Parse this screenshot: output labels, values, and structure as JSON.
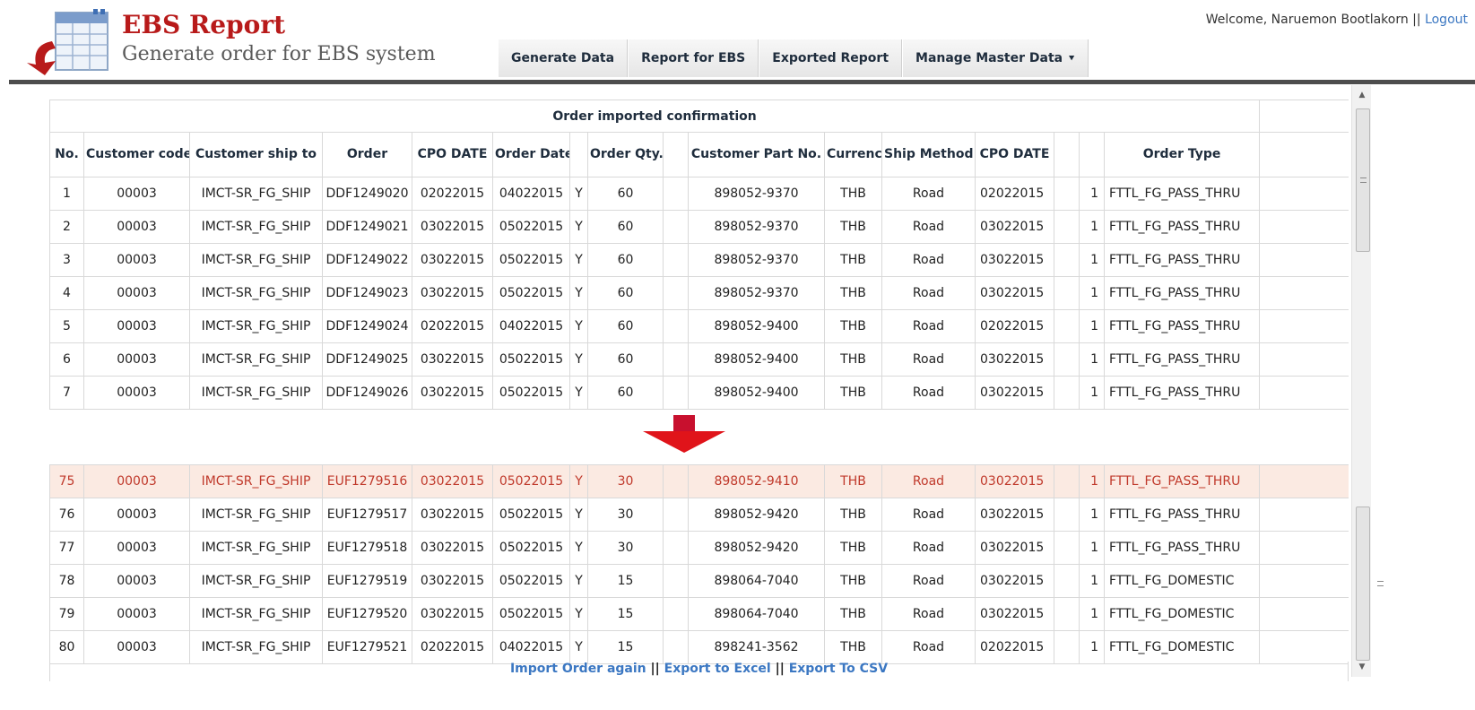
{
  "header": {
    "title": "EBS Report",
    "subtitle": "Generate order for EBS system",
    "welcome_text": "Welcome, Naruemon Bootlakorn ||",
    "logout_label": "Logout"
  },
  "nav": {
    "tabs": [
      {
        "label": "Generate Data"
      },
      {
        "label": "Report for EBS"
      },
      {
        "label": "Exported Report"
      },
      {
        "label": "Manage Master Data"
      }
    ]
  },
  "table": {
    "caption": "Order imported confirmation",
    "columns": [
      "No.",
      "Customer code",
      "Customer ship to",
      "Order",
      "CPO DATE",
      "Order Date",
      "",
      "Order Qty.",
      "",
      "Customer Part No.",
      "Currency",
      "Ship Method",
      "CPO DATE",
      "",
      "",
      "Order Type"
    ],
    "top_rows": [
      [
        "1",
        "00003",
        "IMCT-SR_FG_SHIP",
        "DDF1249020",
        "02022015",
        "04022015",
        "Y",
        "60",
        "",
        "898052-9370",
        "THB",
        "Road",
        "02022015",
        "",
        "1",
        "FTTL_FG_PASS_THRU"
      ],
      [
        "2",
        "00003",
        "IMCT-SR_FG_SHIP",
        "DDF1249021",
        "03022015",
        "05022015",
        "Y",
        "60",
        "",
        "898052-9370",
        "THB",
        "Road",
        "03022015",
        "",
        "1",
        "FTTL_FG_PASS_THRU"
      ],
      [
        "3",
        "00003",
        "IMCT-SR_FG_SHIP",
        "DDF1249022",
        "03022015",
        "05022015",
        "Y",
        "60",
        "",
        "898052-9370",
        "THB",
        "Road",
        "03022015",
        "",
        "1",
        "FTTL_FG_PASS_THRU"
      ],
      [
        "4",
        "00003",
        "IMCT-SR_FG_SHIP",
        "DDF1249023",
        "03022015",
        "05022015",
        "Y",
        "60",
        "",
        "898052-9370",
        "THB",
        "Road",
        "03022015",
        "",
        "1",
        "FTTL_FG_PASS_THRU"
      ],
      [
        "5",
        "00003",
        "IMCT-SR_FG_SHIP",
        "DDF1249024",
        "02022015",
        "04022015",
        "Y",
        "60",
        "",
        "898052-9400",
        "THB",
        "Road",
        "02022015",
        "",
        "1",
        "FTTL_FG_PASS_THRU"
      ],
      [
        "6",
        "00003",
        "IMCT-SR_FG_SHIP",
        "DDF1249025",
        "03022015",
        "05022015",
        "Y",
        "60",
        "",
        "898052-9400",
        "THB",
        "Road",
        "03022015",
        "",
        "1",
        "FTTL_FG_PASS_THRU"
      ],
      [
        "7",
        "00003",
        "IMCT-SR_FG_SHIP",
        "DDF1249026",
        "03022015",
        "05022015",
        "Y",
        "60",
        "",
        "898052-9400",
        "THB",
        "Road",
        "03022015",
        "",
        "1",
        "FTTL_FG_PASS_THRU"
      ]
    ],
    "bottom_rows": [
      [
        "75",
        "00003",
        "IMCT-SR_FG_SHIP",
        "EUF1279516",
        "03022015",
        "05022015",
        "Y",
        "30",
        "",
        "898052-9410",
        "THB",
        "Road",
        "03022015",
        "",
        "1",
        "FTTL_FG_PASS_THRU"
      ],
      [
        "76",
        "00003",
        "IMCT-SR_FG_SHIP",
        "EUF1279517",
        "03022015",
        "05022015",
        "Y",
        "30",
        "",
        "898052-9420",
        "THB",
        "Road",
        "03022015",
        "",
        "1",
        "FTTL_FG_PASS_THRU"
      ],
      [
        "77",
        "00003",
        "IMCT-SR_FG_SHIP",
        "EUF1279518",
        "03022015",
        "05022015",
        "Y",
        "30",
        "",
        "898052-9420",
        "THB",
        "Road",
        "03022015",
        "",
        "1",
        "FTTL_FG_PASS_THRU"
      ],
      [
        "78",
        "00003",
        "IMCT-SR_FG_SHIP",
        "EUF1279519",
        "03022015",
        "05022015",
        "Y",
        "15",
        "",
        "898064-7040",
        "THB",
        "Road",
        "03022015",
        "",
        "1",
        "FTTL_FG_DOMESTIC"
      ],
      [
        "79",
        "00003",
        "IMCT-SR_FG_SHIP",
        "EUF1279520",
        "03022015",
        "05022015",
        "Y",
        "15",
        "",
        "898064-7040",
        "THB",
        "Road",
        "03022015",
        "",
        "1",
        "FTTL_FG_DOMESTIC"
      ],
      [
        "80",
        "00003",
        "IMCT-SR_FG_SHIP",
        "EUF1279521",
        "02022015",
        "04022015",
        "Y",
        "15",
        "",
        "898241-3562",
        "THB",
        "Road",
        "02022015",
        "",
        "1",
        "FTTL_FG_DOMESTIC"
      ]
    ],
    "highlighted_row_no": "75"
  },
  "footer": {
    "import_label": "Import Order again",
    "separator": "||",
    "export_excel_label": "Export to Excel",
    "export_csv_label": "Export To CSV"
  },
  "colors": {
    "brand_red": "#b81a1a",
    "link_blue": "#3b77c2",
    "highlight_bg": "#fbeae2",
    "highlight_text": "#c0392b",
    "arrow_red": "#e0141a"
  },
  "icons": {
    "logo": "report-logo-icon",
    "nav_dropdown": "chevron-down-icon",
    "transition": "down-arrow-icon"
  }
}
